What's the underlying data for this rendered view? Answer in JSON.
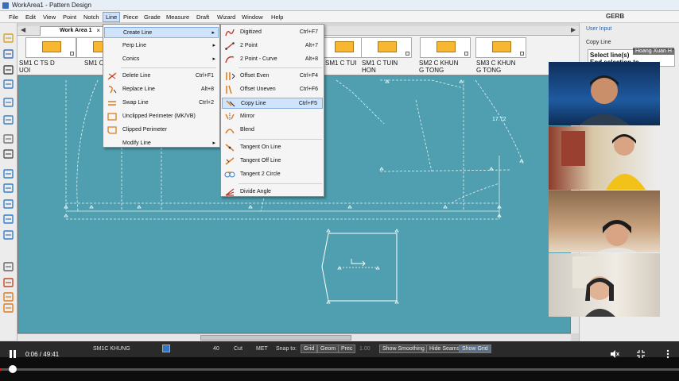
{
  "window": {
    "title": "WorkArea1 - Pattern Design",
    "brand": "GERB"
  },
  "menubar": {
    "items": [
      "File",
      "Edit",
      "View",
      "Point",
      "Notch",
      "Line",
      "Piece",
      "Grade",
      "Measure",
      "Draft",
      "Wizard",
      "Window",
      "Help"
    ],
    "active": "Line"
  },
  "tabs": {
    "work_area": "Work Area 1",
    "close": "×",
    "left_arrow": "◀",
    "right_arrow": "▶"
  },
  "pieces": [
    {
      "label1": "SM1 C TS D",
      "label2": "UOI"
    },
    {
      "label1": "SM1 C",
      "label2": ""
    },
    {
      "label1": "SM1 C TUI",
      "label2": ""
    },
    {
      "label1": "SM1 C TUIN",
      "label2": "HON"
    },
    {
      "label1": "SM2 C KHUN",
      "label2": "G TONG"
    },
    {
      "label1": "SM3 C KHUN",
      "label2": "G TONG"
    }
  ],
  "line_menu": {
    "items": [
      {
        "label": "Create Line",
        "shortcut": "",
        "submenu": true,
        "icon": "none",
        "highlight": true
      },
      {
        "label": "Perp Line",
        "shortcut": "",
        "submenu": true,
        "icon": "none"
      },
      {
        "label": "Conics",
        "shortcut": "",
        "submenu": true,
        "icon": "none"
      },
      {
        "label": "Delete Line",
        "shortcut": "Ctrl+F1",
        "icon": "delete-line-icon"
      },
      {
        "label": "Replace Line",
        "shortcut": "Alt+8",
        "icon": "replace-line-icon"
      },
      {
        "label": "Swap Line",
        "shortcut": "Ctrl+2",
        "icon": "swap-line-icon"
      },
      {
        "label": "Unclipped Perimeter (MK/VB)",
        "shortcut": "",
        "icon": "unclipped-perimeter-icon"
      },
      {
        "label": "Clipped Perimeter",
        "shortcut": "",
        "icon": "clipped-perimeter-icon"
      },
      {
        "label": "Modify Line",
        "shortcut": "",
        "submenu": true,
        "icon": "none"
      }
    ]
  },
  "create_line_menu": {
    "items": [
      {
        "label": "Digitized",
        "shortcut": "Ctrl+F7",
        "icon": "digitized-icon"
      },
      {
        "label": "2 Point",
        "shortcut": "Alt+7",
        "icon": "two-point-icon"
      },
      {
        "label": "2 Point - Curve",
        "shortcut": "Alt+8",
        "icon": "two-point-curve-icon"
      },
      {
        "label": "Offset Even",
        "shortcut": "Ctrl+F4",
        "icon": "offset-even-icon"
      },
      {
        "label": "Offset Uneven",
        "shortcut": "Ctrl+F6",
        "icon": "offset-uneven-icon"
      },
      {
        "label": "Copy Line",
        "shortcut": "Ctrl+F5",
        "icon": "copy-line-icon",
        "highlight": true
      },
      {
        "label": "Mirror",
        "shortcut": "",
        "icon": "mirror-icon"
      },
      {
        "label": "Blend",
        "shortcut": "",
        "icon": "blend-icon"
      },
      {
        "label": "Tangent On Line",
        "shortcut": "",
        "icon": "tangent-on-line-icon"
      },
      {
        "label": "Tangent Off Line",
        "shortcut": "",
        "icon": "tangent-off-line-icon"
      },
      {
        "label": "Tangent 2 Circle",
        "shortcut": "",
        "icon": "tangent-2-circle-icon"
      },
      {
        "label": "Divide Angle",
        "shortcut": "",
        "icon": "divide-angle-icon"
      }
    ]
  },
  "canvas": {
    "measure_label": "17.72",
    "bg_color": "#4f9fb0"
  },
  "right_panel": {
    "header": "User Input",
    "sub": "Copy Line",
    "instruction_1": "Select line(s)",
    "instruction_2": "End selection to"
  },
  "camera": {
    "name": "Hoang Xuan H"
  },
  "statusbar": {
    "piece": "SM1C KHUNG",
    "value1": "40",
    "cut": "Cut",
    "units": "MET",
    "snap_to": "Snap to:",
    "grid": "Grid",
    "geom": "Geom",
    "prec": "Prec",
    "prec_value": "1.00",
    "show_smoothing": "Show Smoothing",
    "hide_seams": "Hide Seams",
    "show_grid": "Show Grid"
  },
  "player": {
    "current": "0:06",
    "duration": "49:41",
    "time_text": "0:06 / 49:41",
    "progress_fraction": 0.0021,
    "accent": "#e21b1b"
  }
}
